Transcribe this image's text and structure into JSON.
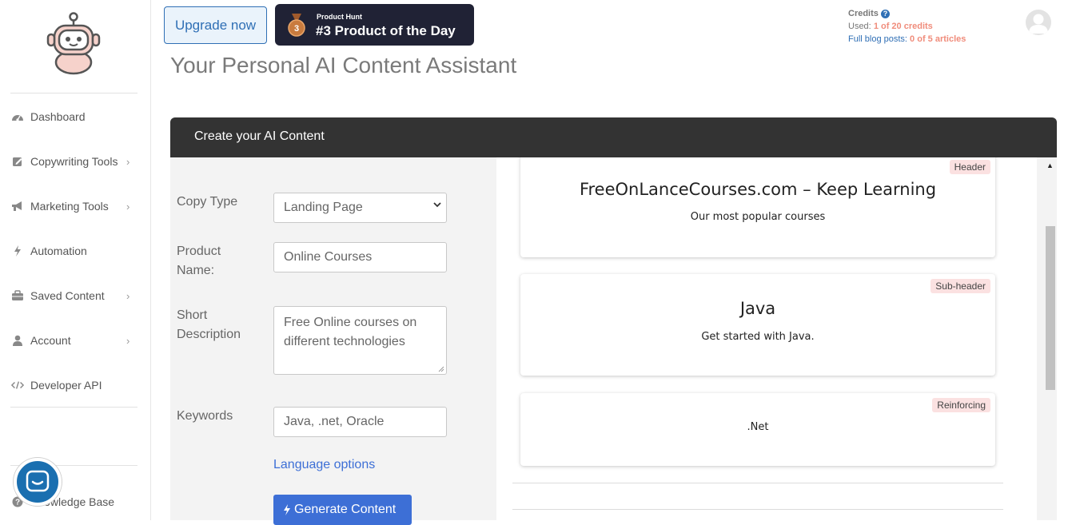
{
  "topbar": {
    "upgrade_label": "Upgrade now",
    "producthunt": {
      "small": "Product Hunt",
      "big": "#3 Product of the Day",
      "rank": "3"
    },
    "credits": {
      "title": "Credits",
      "help_glyph": "?",
      "used_label": "Used:",
      "used_value": "1 of 20 credits",
      "posts_label": "Full blog posts:",
      "posts_value": "0 of 5 articles"
    }
  },
  "page_title": "Your Personal AI Content Assistant",
  "sidebar": {
    "items": [
      {
        "label": "Dashboard",
        "icon": "dashboard-icon"
      },
      {
        "label": "Copywriting Tools",
        "icon": "edit-icon",
        "chevron": "›"
      },
      {
        "label": "Marketing Tools",
        "icon": "bullhorn-icon",
        "chevron": "›"
      },
      {
        "label": "Automation",
        "icon": "bolt-icon"
      },
      {
        "label": "Saved Content",
        "icon": "briefcase-icon",
        "chevron": "›"
      },
      {
        "label": "Account",
        "icon": "user-icon",
        "chevron": "›"
      },
      {
        "label": "Developer API",
        "icon": "code-icon"
      }
    ],
    "knowledge_base": "Knowledge Base"
  },
  "card": {
    "title": "Create your AI Content"
  },
  "form": {
    "copy_type": {
      "label": "Copy Type",
      "value": "Landing Page"
    },
    "product_name": {
      "label_line1": "Product",
      "label_line2": "Name:",
      "value": "Online Courses"
    },
    "short_description": {
      "label_line1": "Short",
      "label_line2": "Description",
      "value_line1": "Free Online courses on",
      "value_line2": "different technologies"
    },
    "keywords": {
      "label": "Keywords",
      "value": "Java, .net, Oracle"
    },
    "language_link": "Language options",
    "generate_label": "Generate Content"
  },
  "results": [
    {
      "tag": "Header",
      "title": "FreeOnLanceCourses.com – Keep Learning",
      "subtitle": "Our most popular courses"
    },
    {
      "tag": "Sub-header",
      "title": "Java",
      "subtitle": "Get started with Java."
    },
    {
      "tag": "Reinforcing",
      "title": "",
      "subtitle": ".Net"
    }
  ],
  "colors": {
    "accent": "#3d6fd6",
    "card_header": "#333333",
    "tag_bg": "#fbe1e1",
    "credits_value": "#f08c7b",
    "chat_bubble": "#1a6fb0"
  }
}
